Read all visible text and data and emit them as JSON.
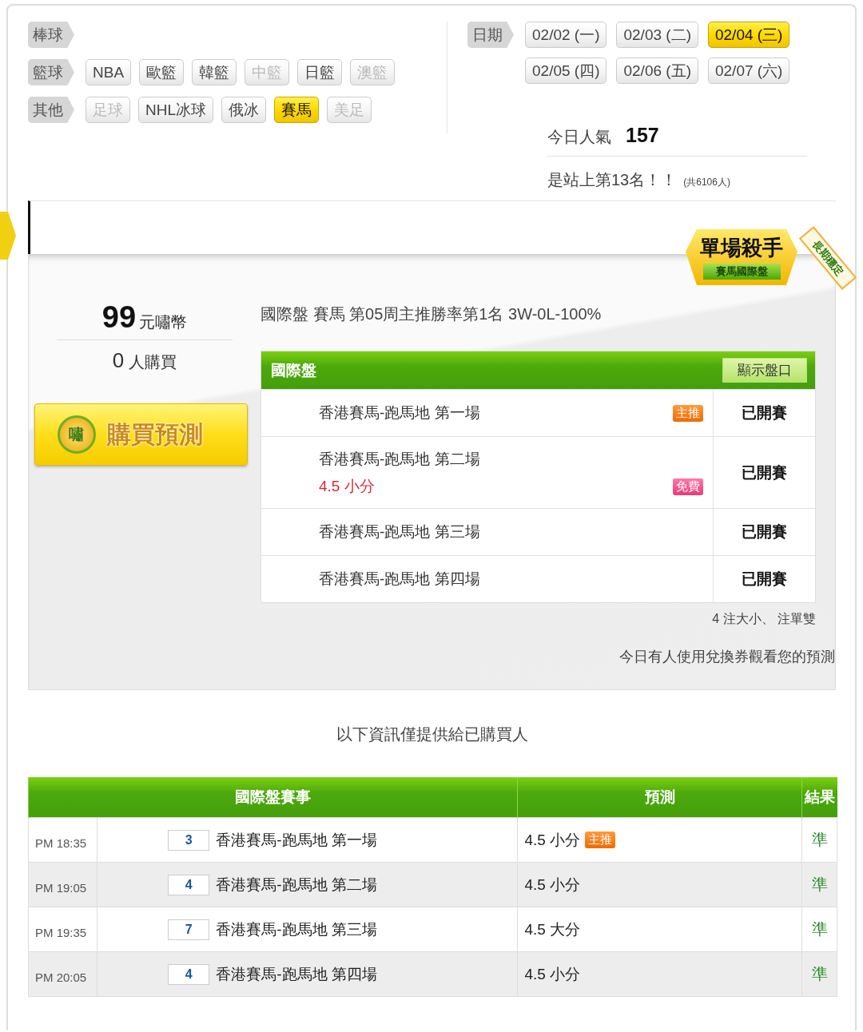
{
  "filters": [
    {
      "label": "棒球"
    },
    {
      "label": "籃球",
      "options": [
        {
          "label": "NBA",
          "disabled": false,
          "selected": false
        },
        {
          "label": "歐籃",
          "disabled": false,
          "selected": false
        },
        {
          "label": "韓籃",
          "disabled": false,
          "selected": false
        },
        {
          "label": "中籃",
          "disabled": true,
          "selected": false
        },
        {
          "label": "日籃",
          "disabled": false,
          "selected": false
        },
        {
          "label": "澳籃",
          "disabled": true,
          "selected": false
        }
      ]
    },
    {
      "label": "其他",
      "options": [
        {
          "label": "足球",
          "disabled": true,
          "selected": false
        },
        {
          "label": "NHL冰球",
          "disabled": false,
          "selected": false
        },
        {
          "label": "俄冰",
          "disabled": false,
          "selected": false
        },
        {
          "label": "賽馬",
          "disabled": false,
          "selected": true
        },
        {
          "label": "美足",
          "disabled": true,
          "selected": false
        }
      ]
    }
  ],
  "dates": {
    "label": "日期",
    "options": [
      {
        "label": "02/02 (一)",
        "selected": false
      },
      {
        "label": "02/03 (二)",
        "selected": false
      },
      {
        "label": "02/04 (三)",
        "selected": true
      },
      {
        "label": "02/05 (四)",
        "selected": false
      },
      {
        "label": "02/06 (五)",
        "selected": false
      },
      {
        "label": "02/07 (六)",
        "selected": false
      }
    ]
  },
  "stats": {
    "popularity_label": "今日人氣",
    "popularity": "157",
    "rank": "是站上第13名！！",
    "total": "(共6106人)"
  },
  "badge": {
    "title": "單場殺手",
    "subtitle": "賽馬國際盤",
    "ribbon": "長期穩定"
  },
  "offer": {
    "price": "99",
    "unit": "元嘯幣",
    "buyers": "0",
    "buyers_label": "人購買",
    "coin_text": "嘯",
    "buy_button": "購買預測"
  },
  "headline": "國際盤 賽馬 第05周主推勝率第1名 3W-0L-100%",
  "preview": {
    "title": "國際盤",
    "toggle": "顯示盤口",
    "rows": [
      {
        "match": "香港賽馬-跑馬地 第一場",
        "tag": {
          "kind": "main",
          "label": "主推"
        },
        "status": "已開賽"
      },
      {
        "match": "香港賽馬-跑馬地 第二場",
        "pick": "4.5 小分",
        "tag": {
          "kind": "free",
          "label": "免費"
        },
        "status": "已開賽"
      },
      {
        "match": "香港賽馬-跑馬地 第三場",
        "status": "已開賽"
      },
      {
        "match": "香港賽馬-跑馬地 第四場",
        "status": "已開賽"
      }
    ]
  },
  "summary": "4 注大小、 注單雙",
  "note": "今日有人使用兌換券觀看您的預測",
  "info": "以下資訊僅提供給已購買人",
  "results": {
    "columns": [
      "國際盤賽事",
      "預測",
      "結果"
    ],
    "rows": [
      {
        "time": "PM 18:35",
        "number": "3",
        "match": "香港賽馬-跑馬地 第一場",
        "pick": "4.5 小分",
        "tag": {
          "kind": "main",
          "label": "主推"
        },
        "result": "準"
      },
      {
        "time": "PM 19:05",
        "number": "4",
        "match": "香港賽馬-跑馬地 第二場",
        "pick": "4.5 小分",
        "result": "準"
      },
      {
        "time": "PM 19:35",
        "number": "7",
        "match": "香港賽馬-跑馬地 第三場",
        "pick": "4.5 大分",
        "result": "準"
      },
      {
        "time": "PM 20:05",
        "number": "4",
        "match": "香港賽馬-跑馬地 第四場",
        "pick": "4.5 小分",
        "result": "準"
      }
    ]
  }
}
